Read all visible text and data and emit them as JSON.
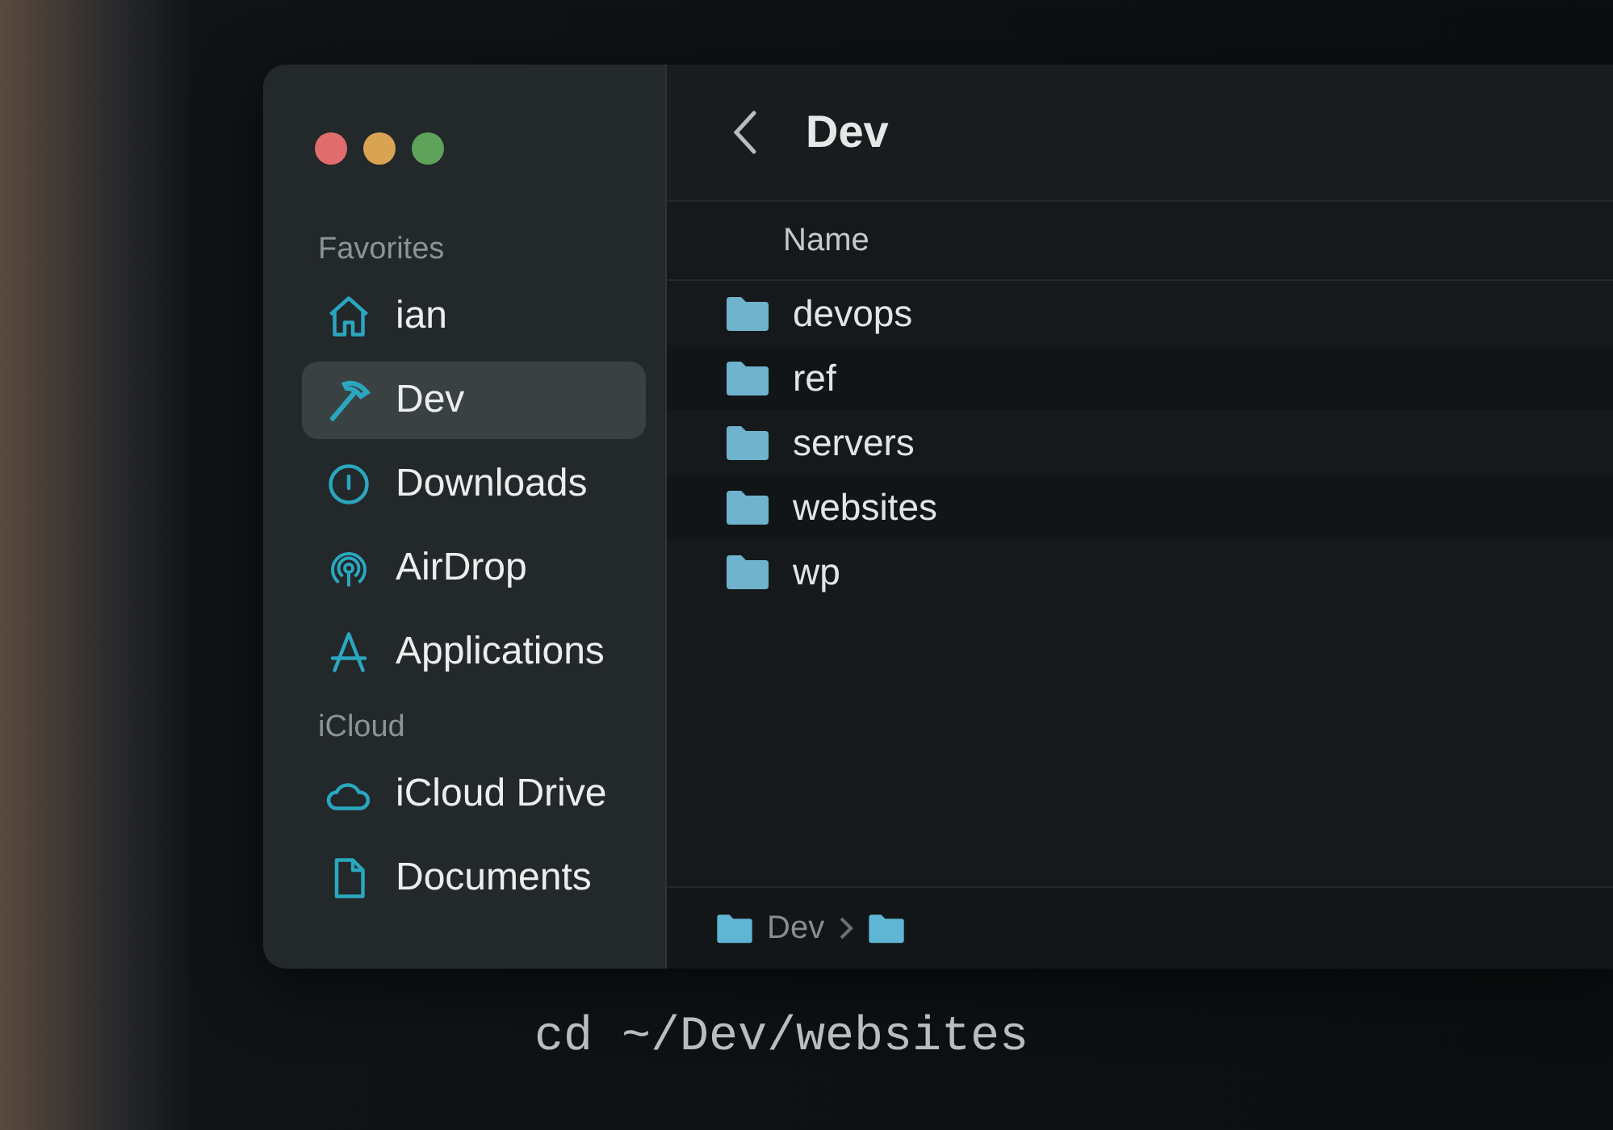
{
  "window": {
    "title": "Dev"
  },
  "sidebar": {
    "sections": [
      {
        "heading": "Favorites",
        "items": [
          {
            "label": "ian",
            "kind": "home",
            "selected": false
          },
          {
            "label": "Dev",
            "kind": "hammer",
            "selected": true
          },
          {
            "label": "Downloads",
            "kind": "download",
            "selected": false
          },
          {
            "label": "AirDrop",
            "kind": "airdrop",
            "selected": false
          },
          {
            "label": "Applications",
            "kind": "apps",
            "selected": false
          }
        ]
      },
      {
        "heading": "iCloud",
        "items": [
          {
            "label": "iCloud Drive",
            "kind": "cloud",
            "selected": false
          },
          {
            "label": "Documents",
            "kind": "document",
            "selected": false
          }
        ]
      }
    ]
  },
  "table": {
    "columns": [
      "Name"
    ],
    "rows": [
      {
        "name": "devops"
      },
      {
        "name": "ref"
      },
      {
        "name": "servers"
      },
      {
        "name": "websites"
      },
      {
        "name": "wp"
      }
    ]
  },
  "path_bar": [
    "Dev"
  ],
  "terminal": {
    "command": "cd ~/Dev/websites"
  }
}
